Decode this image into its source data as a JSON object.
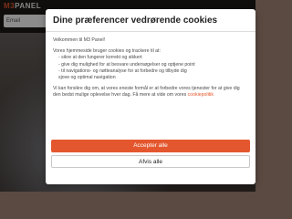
{
  "background": {
    "logo_prefix": "M3",
    "logo_suffix": "PANEL",
    "search_placeholder": "Email"
  },
  "cookie_dialog": {
    "title": "Dine præferencer vedrørende cookies",
    "greeting": "Velkommen til M3 Panel!",
    "intro": "Vores hjemmeside bruger cookies og trackere til at:",
    "bullets": [
      "- sikre at den fungerer korrekt og sikkert",
      "- give dig mulighed for at besvare undersøgelser og optjene point",
      "- til navigations- og nøtteanalyse for at forbedre og tilbyde dig",
      "  sjove og optimal navigation"
    ],
    "outro": "Vi kan forsikre dig om, at vores eneste formål er at forbedre vores tjenester for at give dig den bedst mulige oplevelse hver dag. Få mere at vide om vores",
    "policy_link": "cookiepolitik",
    "accept_label": "Accepter alle",
    "reject_label": "Afvis alle"
  },
  "colors": {
    "accent": "#e4572e"
  }
}
